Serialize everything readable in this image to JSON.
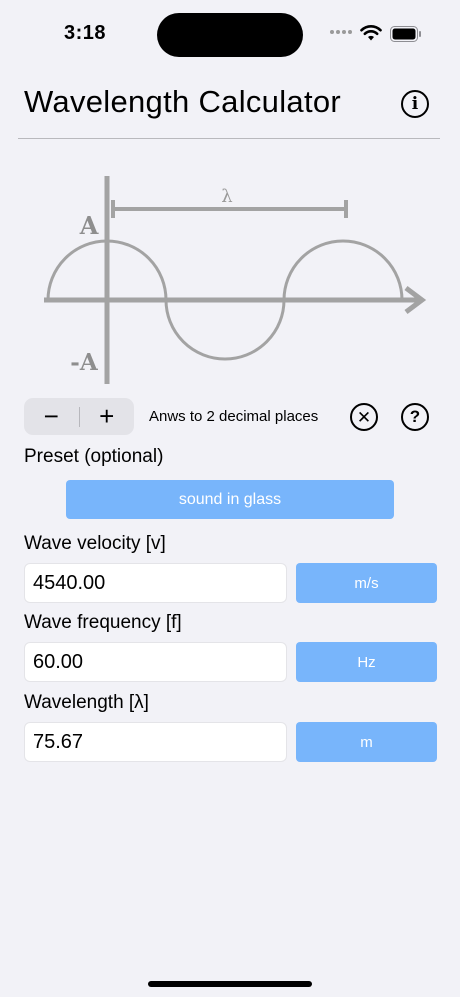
{
  "status_bar": {
    "time": "3:18"
  },
  "header": {
    "title": "Wavelength Calculator",
    "info_icon": "info-circle-icon"
  },
  "diagram": {
    "lambda_label": "λ",
    "amplitude_label": "A",
    "neg_amplitude_label": "-A",
    "color": "#a0a0a0"
  },
  "controls": {
    "minus_label": "−",
    "plus_label": "+",
    "decimal_text": "Anws to 2 decimal places",
    "clear_icon": "x-circle-icon",
    "help_icon": "question-circle-icon"
  },
  "preset": {
    "label": "Preset (optional)",
    "value": "sound in glass"
  },
  "fields": {
    "velocity": {
      "label": "Wave velocity [v]",
      "value": "4540.00",
      "unit": "m/s"
    },
    "frequency": {
      "label": "Wave frequency [f]",
      "value": "60.00",
      "unit": "Hz"
    },
    "wavelength": {
      "label": "Wavelength [λ]",
      "value": "75.67",
      "unit": "m"
    }
  },
  "colors": {
    "accent": "#78b5fb",
    "background": "#f2f2f7"
  }
}
